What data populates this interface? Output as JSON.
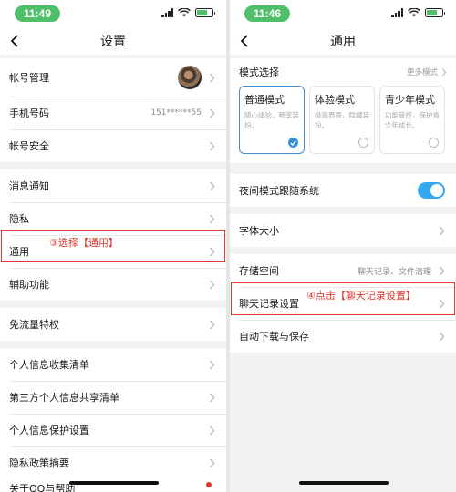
{
  "left": {
    "time": "11:49",
    "title": "设置",
    "rows": {
      "account": "帐号管理",
      "phone": "手机号码",
      "phone_value": "151******55",
      "security": "帐号安全",
      "notify": "消息通知",
      "privacy": "隐私",
      "general": "通用",
      "assist": "辅助功能",
      "freeflow": "免流量特权",
      "collect": "个人信息收集清单",
      "thirdparty": "第三方个人信息共享清单",
      "protect": "个人信息保护设置",
      "policy": "隐私政策摘要",
      "about": "关于QQ与帮助"
    },
    "annotation": "③选择【通用】"
  },
  "right": {
    "time": "11:46",
    "title": "通用",
    "mode_title": "模式选择",
    "mode_more": "更多模式",
    "modes": [
      {
        "name": "普通模式",
        "desc": "随心体验，畅享装扮。",
        "selected": true
      },
      {
        "name": "体验模式",
        "desc": "极简界面，隐藏装扮。",
        "selected": false
      },
      {
        "name": "青少年模式",
        "desc": "功能管控，保护青少年成长。",
        "selected": false
      }
    ],
    "rows": {
      "night": "夜间模式跟随系统",
      "font": "字体大小",
      "storage": "存储空间",
      "storage_value": "聊天记录、文件清理",
      "chatlog": "聊天记录设置",
      "autodl": "自动下载与保存"
    },
    "night_on": true,
    "annotation": "④点击【聊天记录设置】"
  },
  "colors": {
    "annotation": "#e0362b",
    "accent": "#3a8fdc",
    "toggle": "#34a7ee",
    "time_pill": "#4fbf6a"
  }
}
